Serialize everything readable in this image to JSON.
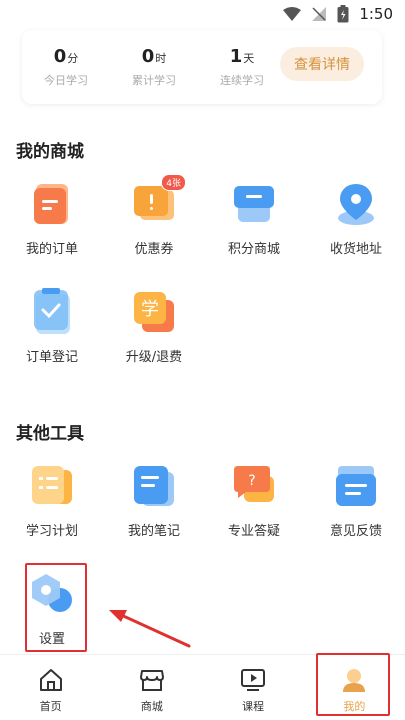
{
  "status_bar": {
    "time": "1:50"
  },
  "stats": {
    "items": [
      {
        "value": "0",
        "unit": "分",
        "label": "今日学习"
      },
      {
        "value": "0",
        "unit": "时",
        "label": "累计学习"
      },
      {
        "value": "1",
        "unit": "天",
        "label": "连续学习"
      }
    ],
    "detail_button": "查看详情"
  },
  "mall": {
    "title": "我的商城",
    "items": [
      {
        "label": "我的订单",
        "icon": "order-icon"
      },
      {
        "label": "优惠券",
        "icon": "coupon-icon",
        "badge": "4张"
      },
      {
        "label": "积分商城",
        "icon": "points-store-icon"
      },
      {
        "label": "收货地址",
        "icon": "location-icon"
      },
      {
        "label": "订单登记",
        "icon": "order-register-icon"
      },
      {
        "label": "升级/退费",
        "icon": "upgrade-refund-icon"
      }
    ]
  },
  "tools": {
    "title": "其他工具",
    "items": [
      {
        "label": "学习计划",
        "icon": "study-plan-icon"
      },
      {
        "label": "我的笔记",
        "icon": "notes-icon"
      },
      {
        "label": "专业答疑",
        "icon": "qa-icon"
      },
      {
        "label": "意见反馈",
        "icon": "feedback-icon"
      },
      {
        "label": "设置",
        "icon": "settings-icon"
      }
    ]
  },
  "tabbar": {
    "items": [
      {
        "label": "首页",
        "icon": "home-icon"
      },
      {
        "label": "商城",
        "icon": "store-icon"
      },
      {
        "label": "课程",
        "icon": "course-icon"
      },
      {
        "label": "我的",
        "icon": "profile-icon"
      }
    ]
  },
  "colors": {
    "accent": "#e8a24d",
    "highlight_box": "#e03030",
    "badge": "#f15a4a"
  }
}
